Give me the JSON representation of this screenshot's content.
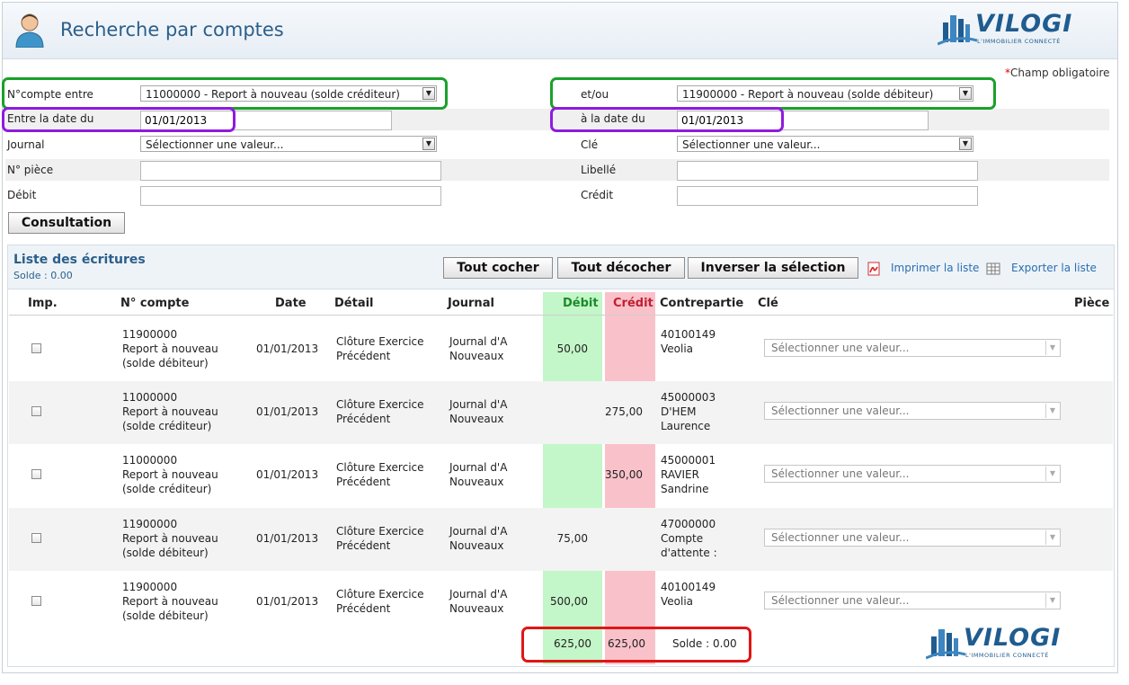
{
  "header": {
    "title": "Recherche par comptes",
    "logo_word": "VILOGI",
    "logo_tagline": "L'IMMOBILIER CONNECTÉ"
  },
  "form": {
    "required_star": "*",
    "required_note": "Champ obligatoire",
    "account_from_label": "N°compte entre",
    "account_from_value": "11000000 - Report à nouveau (solde créditeur)",
    "account_to_label": "et/ou",
    "account_to_value": "11900000 - Report à nouveau (solde débiteur)",
    "date_from_label": "Entre la date du",
    "date_from_value": "01/01/2013",
    "date_to_label": "à la date du",
    "date_to_value": "01/01/2013",
    "journal_label": "Journal",
    "journal_value": "Sélectionner une valeur...",
    "cle_label": "Clé",
    "cle_value": "Sélectionner une valeur...",
    "piece_label": "N° pièce",
    "piece_value": "",
    "libelle_label": "Libellé",
    "libelle_value": "",
    "debit_label": "Débit",
    "debit_value": "",
    "credit_label": "Crédit",
    "credit_value": "",
    "submit_label": "Consultation"
  },
  "list": {
    "title": "Liste des écritures",
    "solde": "Solde : 0.00",
    "check_all": "Tout cocher",
    "uncheck_all": "Tout décocher",
    "invert": "Inverser la sélection",
    "print": "Imprimer la liste",
    "export": "Exporter la liste",
    "columns": [
      "Imp.",
      "N° compte",
      "Date",
      "Détail",
      "Journal",
      "Débit",
      "Crédit",
      "Contrepartie",
      "Clé",
      "Pièce"
    ],
    "rows": [
      {
        "acct": "11900000",
        "acct_name1": "Report à nouveau",
        "acct_name2": "(solde débiteur)",
        "date": "01/01/2013",
        "detail1": "Clôture Exercice",
        "detail2": "Précédent",
        "journal1": "Journal d'A",
        "journal2": "Nouveaux",
        "debit": "50,00",
        "credit": "",
        "contra1": "40100149",
        "contra2": "Veolia",
        "contra3": "",
        "cle": "Sélectionner une valeur..."
      },
      {
        "acct": "11000000",
        "acct_name1": "Report à nouveau",
        "acct_name2": "(solde créditeur)",
        "date": "01/01/2013",
        "detail1": "Clôture Exercice",
        "detail2": "Précédent",
        "journal1": "Journal d'A",
        "journal2": "Nouveaux",
        "debit": "",
        "credit": "275,00",
        "contra1": "45000003",
        "contra2": "D'HEM",
        "contra3": "Laurence",
        "cle": "Sélectionner une valeur..."
      },
      {
        "acct": "11000000",
        "acct_name1": "Report à nouveau",
        "acct_name2": "(solde créditeur)",
        "date": "01/01/2013",
        "detail1": "Clôture Exercice",
        "detail2": "Précédent",
        "journal1": "Journal d'A",
        "journal2": "Nouveaux",
        "debit": "",
        "credit": "350,00",
        "contra1": "45000001",
        "contra2": "RAVIER",
        "contra3": "Sandrine",
        "cle": "Sélectionner une valeur..."
      },
      {
        "acct": "11900000",
        "acct_name1": "Report à nouveau",
        "acct_name2": "(solde débiteur)",
        "date": "01/01/2013",
        "detail1": "Clôture Exercice",
        "detail2": "Précédent",
        "journal1": "Journal d'A",
        "journal2": "Nouveaux",
        "debit": "75,00",
        "credit": "",
        "contra1": "47000000",
        "contra2": "Compte",
        "contra3": "d'attente :",
        "cle": "Sélectionner une valeur..."
      },
      {
        "acct": "11900000",
        "acct_name1": "Report à nouveau",
        "acct_name2": "(solde débiteur)",
        "date": "01/01/2013",
        "detail1": "Clôture Exercice",
        "detail2": "Précédent",
        "journal1": "Journal d'A",
        "journal2": "Nouveaux",
        "debit": "500,00",
        "credit": "",
        "contra1": "40100149",
        "contra2": "Veolia",
        "contra3": "",
        "cle": "Sélectionner une valeur..."
      }
    ],
    "total_debit": "625,00",
    "total_credit": "625,00",
    "total_solde": "Solde : 0.00"
  },
  "colors": {
    "accent": "#2b5f8a",
    "debit_bg": "#c3f6c8",
    "credit_bg": "#f9c2ca",
    "highlight_green": "#1aa12b",
    "highlight_purple": "#8e1be0",
    "highlight_red": "#e01616"
  }
}
